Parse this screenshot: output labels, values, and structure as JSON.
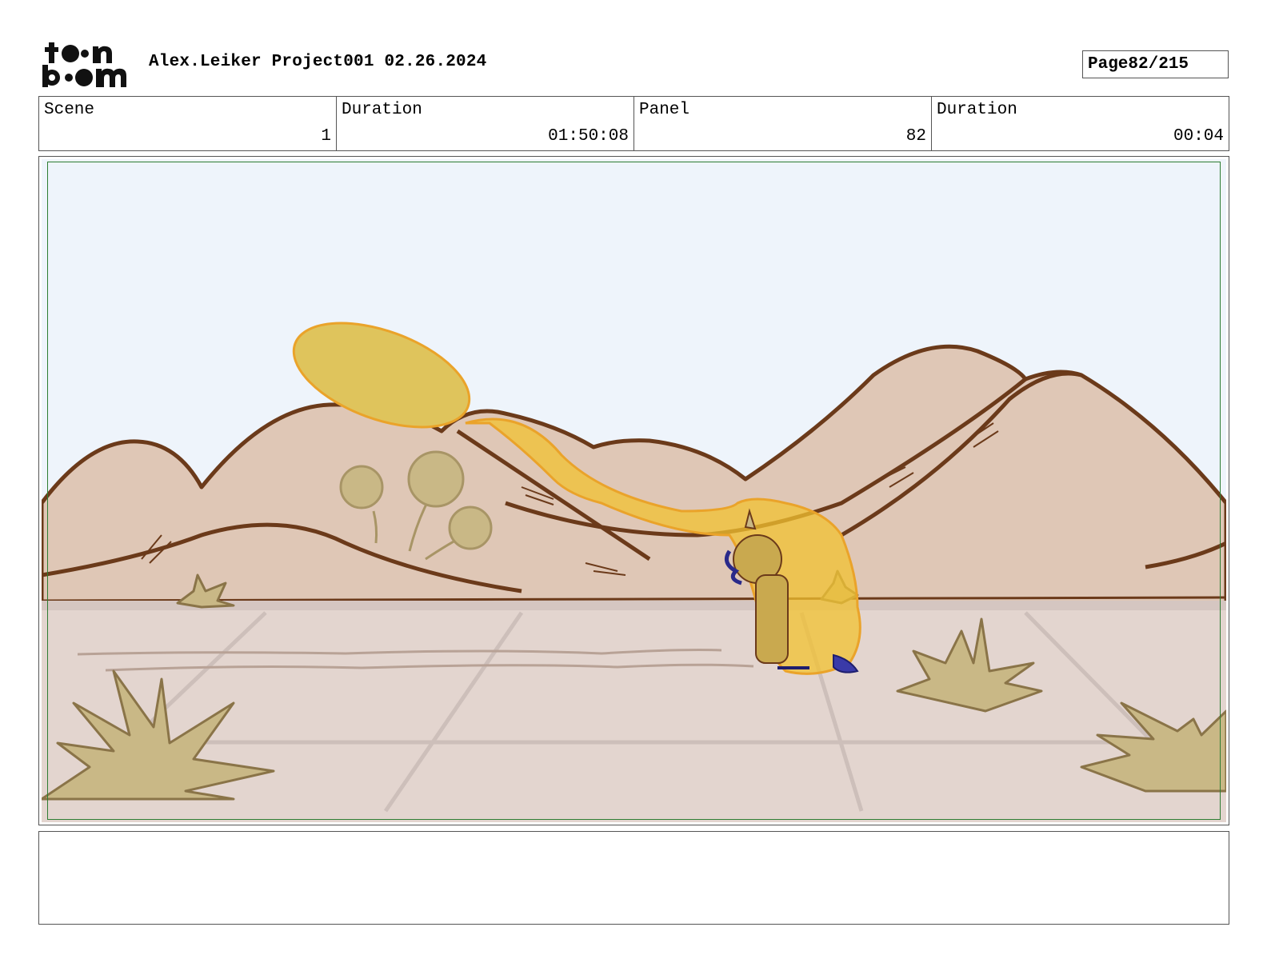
{
  "header": {
    "logo_text": "toon boom",
    "title": "Alex.Leiker Project001 02.26.2024",
    "page_label": "Page",
    "page_value": "82/215"
  },
  "info": {
    "scene_label": "Scene",
    "scene_value": "1",
    "scene_duration_label": "Duration",
    "scene_duration_value": "01:50:08",
    "panel_label": "Panel",
    "panel_value": "82",
    "panel_duration_label": "Duration",
    "panel_duration_value": "00:04"
  },
  "panel": {
    "colors": {
      "sky": "#eef4fb",
      "hills": "#dfc7b6",
      "outline": "#6b3a1a",
      "ground": "#e3d5cf",
      "plants": "#c9b886",
      "fire": "#f2c230",
      "safe_frame": "#2e7d32"
    }
  },
  "notes": {
    "text": ""
  }
}
